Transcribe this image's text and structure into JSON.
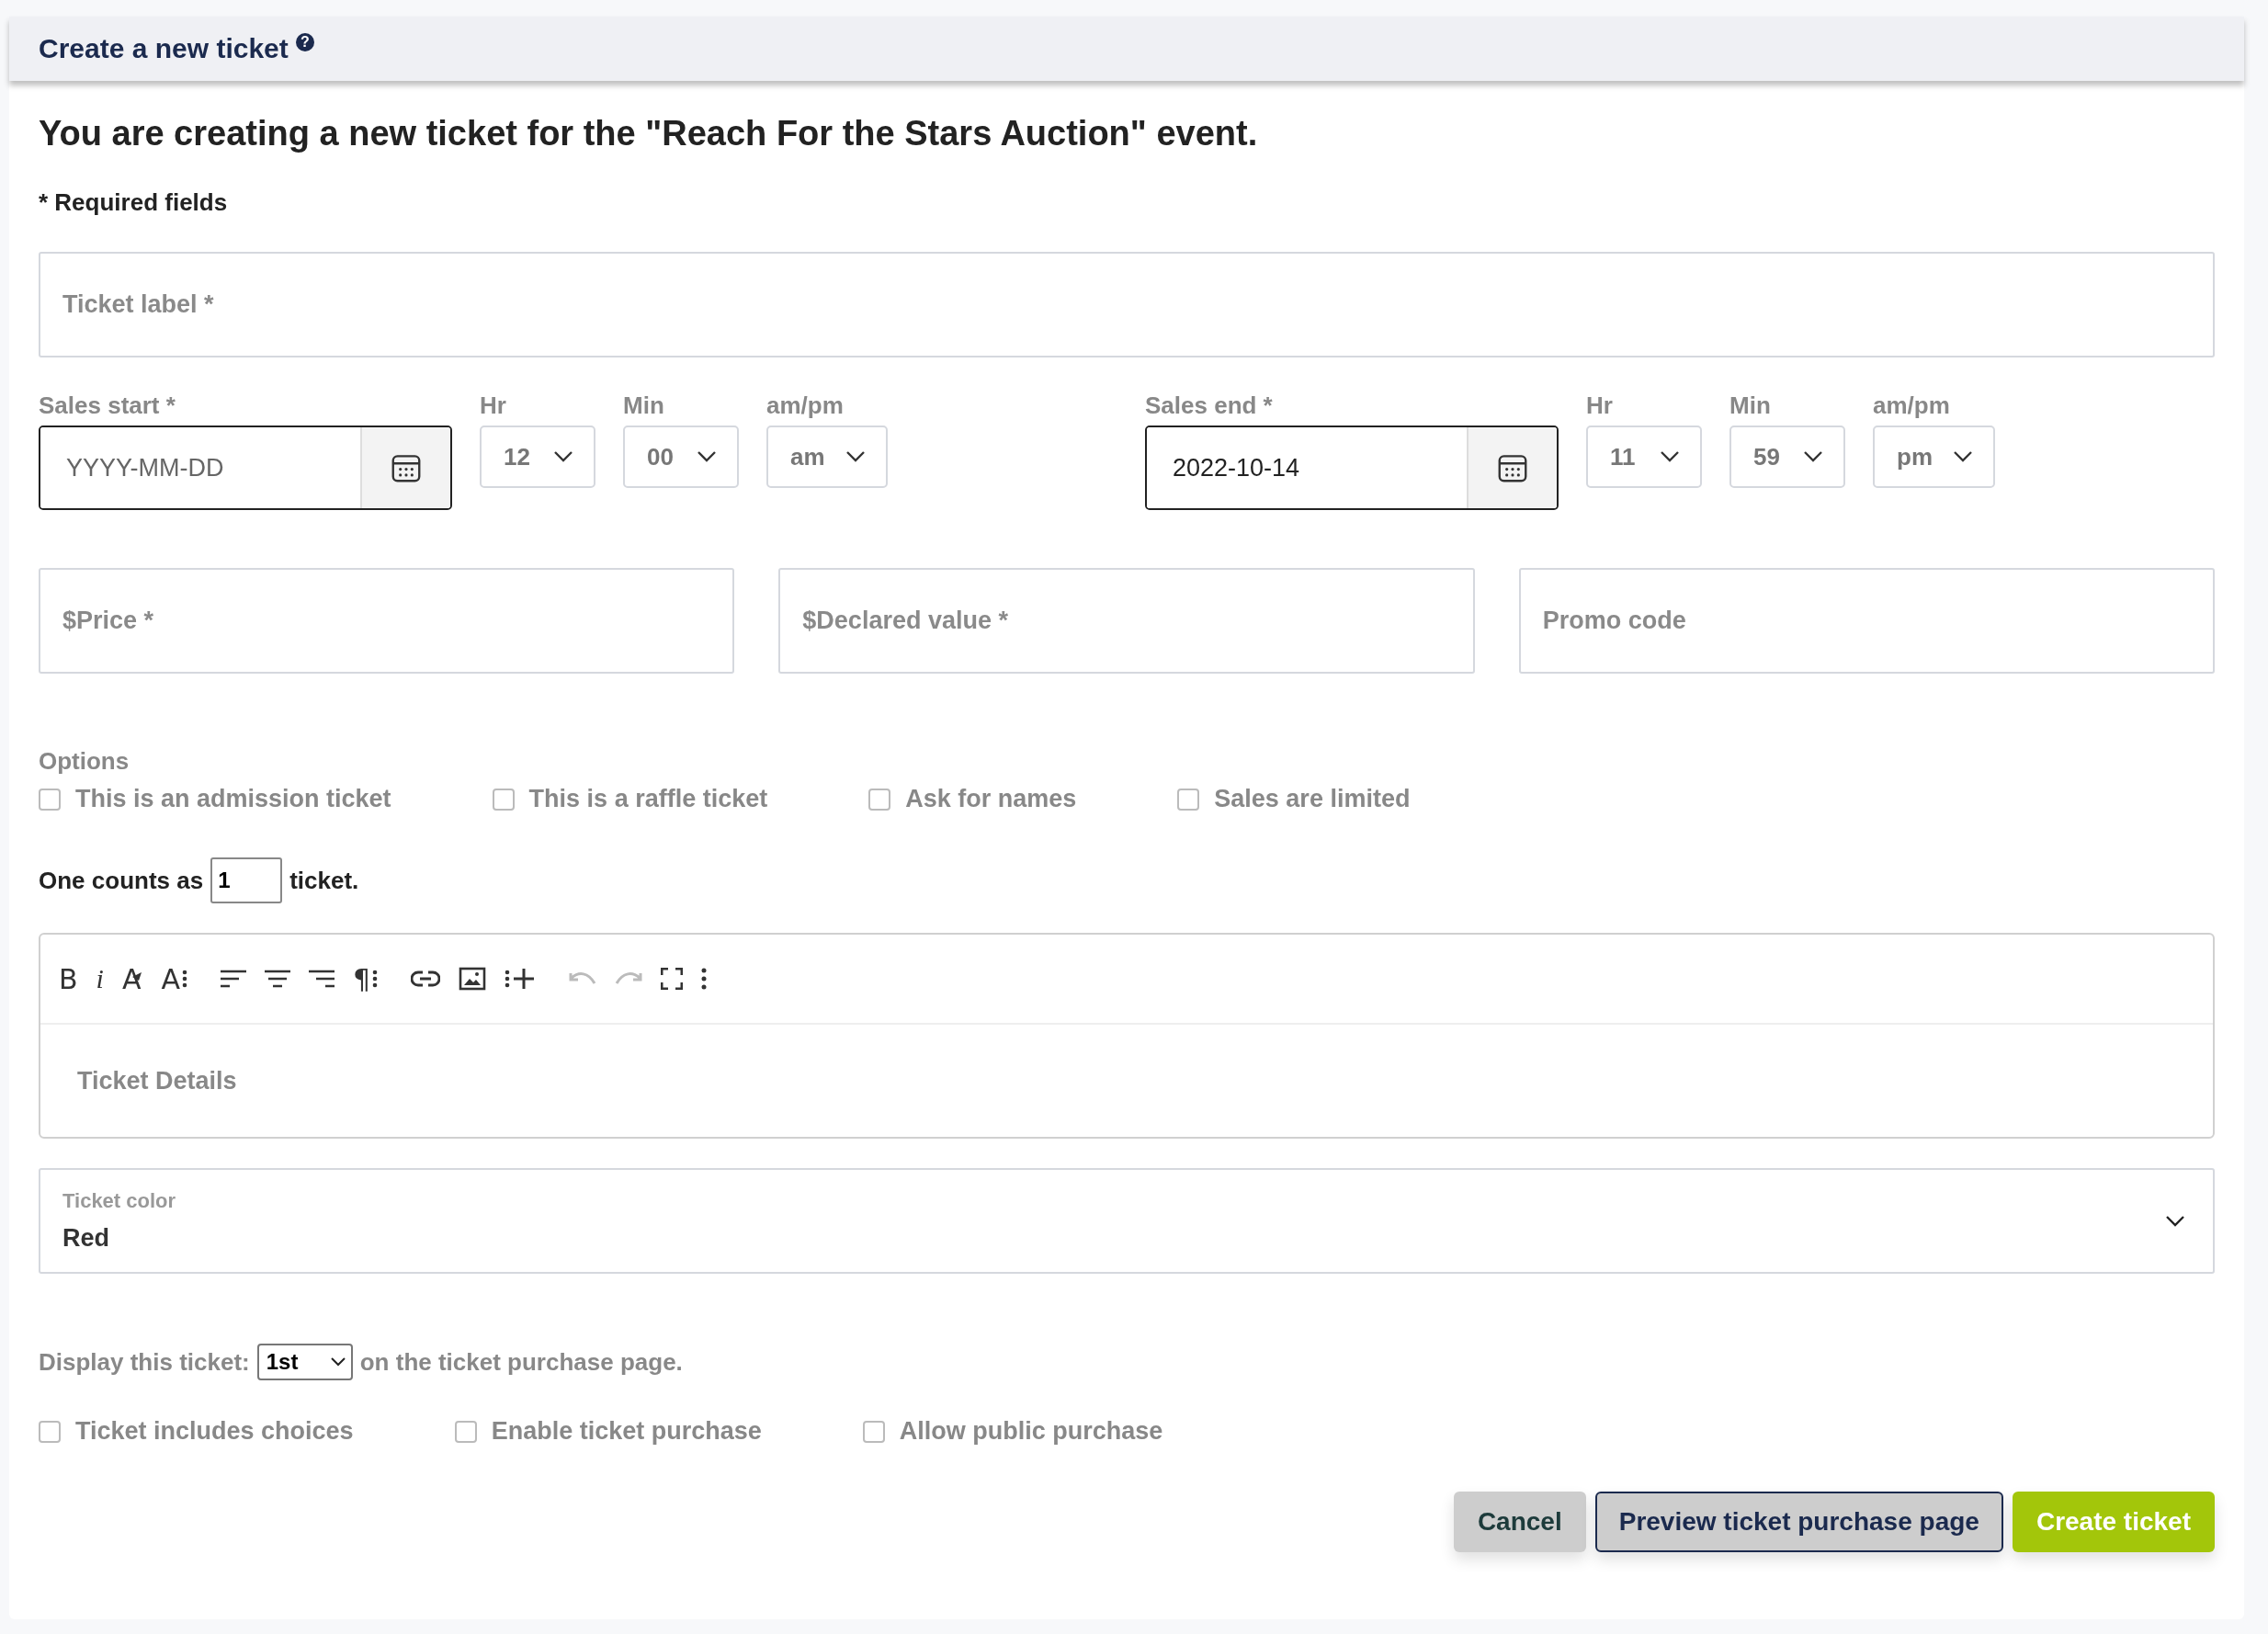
{
  "header": {
    "title": "Create a new ticket",
    "help_glyph": "?"
  },
  "intro": "You are creating a new ticket for the \"Reach For the Stars Auction\" event.",
  "required_note": "* Required fields",
  "ticket_label": {
    "placeholder": "Ticket label *"
  },
  "sales": [
    {
      "label": "Sales start *",
      "date": {
        "placeholder": "YYYY-MM-DD"
      },
      "selects": [
        {
          "label": "Hr",
          "value": "12"
        },
        {
          "label": "Min",
          "value": "00"
        },
        {
          "label": "am/pm",
          "value": "am"
        }
      ]
    },
    {
      "label": "Sales end *",
      "date": {
        "value": "2022-10-14"
      },
      "selects": [
        {
          "label": "Hr",
          "value": "11"
        },
        {
          "label": "Min",
          "value": "59"
        },
        {
          "label": "am/pm",
          "value": "pm"
        }
      ]
    }
  ],
  "amount_fields": [
    {
      "placeholder": "$Price *"
    },
    {
      "placeholder": "$Declared value *"
    },
    {
      "placeholder": "Promo code"
    }
  ],
  "options": {
    "label": "Options",
    "items": [
      {
        "label": "This is an admission ticket",
        "checked": false
      },
      {
        "label": "This is a raffle ticket",
        "checked": false
      },
      {
        "label": "Ask for names",
        "checked": false
      },
      {
        "label": "Sales are limited",
        "checked": false
      }
    ]
  },
  "counts": {
    "before": "One counts as",
    "value": "1",
    "after": "ticket."
  },
  "editor": {
    "toolbar_groups": [
      [
        {
          "kind": "bold",
          "glyph": "B",
          "disabled": false
        },
        {
          "kind": "italic",
          "glyph": "i",
          "disabled": false
        },
        {
          "kind": "clear-format",
          "glyph": "A",
          "disabled": false
        },
        {
          "kind": "font-size",
          "glyph": "A",
          "disabled": false
        }
      ],
      [
        {
          "kind": "align-left",
          "disabled": false
        },
        {
          "kind": "align-center",
          "disabled": false
        },
        {
          "kind": "align-right",
          "disabled": false
        },
        {
          "kind": "paragraph",
          "glyph": "¶",
          "disabled": false
        }
      ],
      [
        {
          "kind": "link",
          "disabled": false
        },
        {
          "kind": "image",
          "disabled": false
        },
        {
          "kind": "insert",
          "disabled": false
        }
      ],
      [
        {
          "kind": "undo",
          "disabled": true
        },
        {
          "kind": "redo",
          "disabled": true
        },
        {
          "kind": "fullscreen",
          "disabled": false
        },
        {
          "kind": "more",
          "disabled": false
        }
      ]
    ],
    "placeholder": "Ticket Details"
  },
  "ticket_color": {
    "label": "Ticket color",
    "value": "Red"
  },
  "display_order": {
    "before": "Display this ticket:",
    "value": "1st",
    "after": "on the ticket purchase page."
  },
  "flags": [
    {
      "label": "Ticket includes choices",
      "checked": false
    },
    {
      "label": "Enable ticket purchase",
      "checked": false
    },
    {
      "label": "Allow public purchase",
      "checked": false
    }
  ],
  "buttons": [
    {
      "label": "Cancel",
      "kind": "cancel"
    },
    {
      "label": "Preview ticket purchase page",
      "kind": "secondary"
    },
    {
      "label": "Create ticket",
      "kind": "primary"
    }
  ]
}
